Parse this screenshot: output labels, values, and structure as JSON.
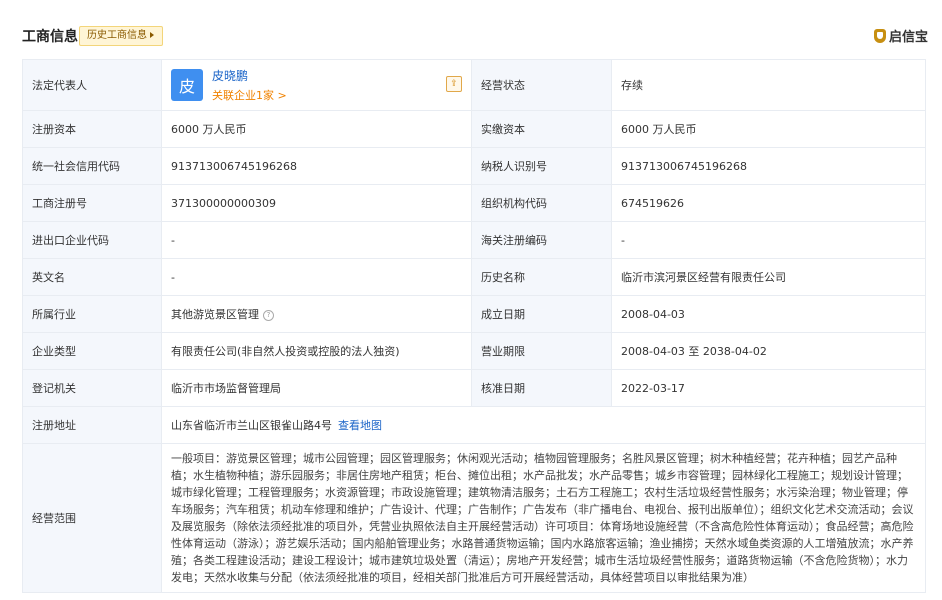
{
  "header": {
    "title": "工商信息",
    "history_button": "历史工商信息",
    "brand": "启信宝"
  },
  "legal_rep": {
    "label": "法定代表人",
    "avatar_char": "皮",
    "name": "皮晓鹏",
    "related": "关联企业1家 >"
  },
  "fields": {
    "status_label": "经营状态",
    "status": "存续",
    "reg_capital_label": "注册资本",
    "reg_capital": "6000 万人民币",
    "paid_capital_label": "实缴资本",
    "paid_capital": "6000 万人民币",
    "credit_code_label": "统一社会信用代码",
    "credit_code": "913713006745196268",
    "taxpayer_label": "纳税人识别号",
    "taxpayer": "913713006745196268",
    "reg_no_label": "工商注册号",
    "reg_no": "371300000000309",
    "org_code_label": "组织机构代码",
    "org_code": "674519626",
    "import_label": "进出口企业代码",
    "import": "-",
    "customs_label": "海关注册编码",
    "customs": "-",
    "english_label": "英文名",
    "english": "-",
    "former_label": "历史名称",
    "former": "临沂市滨河景区经营有限责任公司",
    "industry_label": "所属行业",
    "industry": "其他游览景区管理",
    "found_label": "成立日期",
    "found": "2008-04-03",
    "type_label": "企业类型",
    "type": "有限责任公司(非自然人投资或控股的法人独资)",
    "term_label": "营业期限",
    "term": "2008-04-03 至 2038-04-02",
    "authority_label": "登记机关",
    "authority": "临沂市市场监督管理局",
    "approve_label": "核准日期",
    "approve": "2022-03-17",
    "address_label": "注册地址",
    "address": "山东省临沂市兰山区银雀山路4号",
    "map_link": "查看地图",
    "scope_label": "经营范围",
    "scope": "一般项目：游览景区管理；城市公园管理；园区管理服务；休闲观光活动；植物园管理服务；名胜风景区管理；树木种植经营；花卉种植；园艺产品种植；水生植物种植；游乐园服务；非居住房地产租赁；柜台、摊位出租；水产品批发；水产品零售；城乡市容管理；园林绿化工程施工；规划设计管理；城市绿化管理；工程管理服务；水资源管理；市政设施管理；建筑物清洁服务；土石方工程施工；农村生活垃圾经营性服务；水污染治理；物业管理；停车场服务；汽车租赁；机动车修理和维护；广告设计、代理；广告制作；广告发布（非广播电台、电视台、报刊出版单位）；组织文化艺术交流活动；会议及展览服务（除依法须经批准的项目外，凭营业执照依法自主开展经营活动）许可项目：体育场地设施经营（不含高危险性体育运动）；食品经营；高危险性体育运动（游泳）；游艺娱乐活动；国内船舶管理业务；水路普通货物运输；国内水路旅客运输；渔业捕捞；天然水域鱼类资源的人工增殖放流；水产养殖；各类工程建设活动；建设工程设计；城市建筑垃圾处置（清运）；房地产开发经营；城市生活垃圾经营性服务；道路货物运输（不含危险货物）；水力发电；天然水收集与分配（依法须经批准的项目，经相关部门批准后方可开展经营活动，具体经营项目以审批结果为准）"
  }
}
